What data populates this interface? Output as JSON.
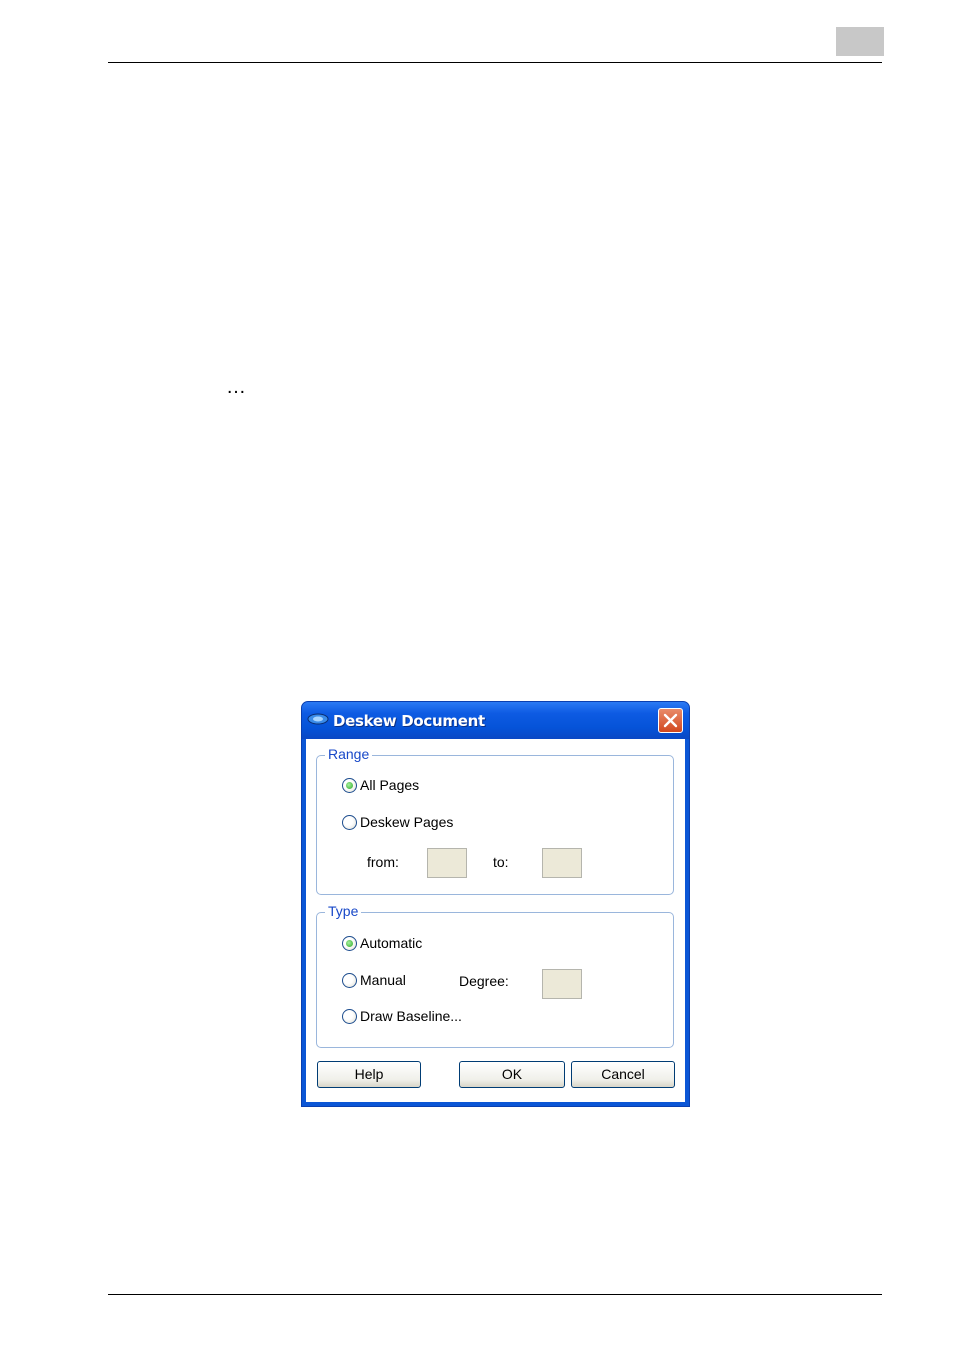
{
  "dialog": {
    "title": "Deskew Document",
    "range": {
      "legend": "Range",
      "all_pages": "All Pages",
      "deskew_pages": "Deskew Pages",
      "from_label": "from:",
      "to_label": "to:",
      "from_value": "",
      "to_value": "",
      "selected": "all_pages"
    },
    "type": {
      "legend": "Type",
      "automatic": "Automatic",
      "manual": "Manual",
      "degree_label": "Degree:",
      "degree_value": "",
      "draw_baseline": "Draw Baseline...",
      "selected": "automatic"
    },
    "buttons": {
      "help": "Help",
      "ok": "OK",
      "cancel": "Cancel"
    }
  },
  "page": {
    "ellipsis": "…"
  },
  "colors": {
    "titlebar": "#0553d8",
    "group_legend": "#1848c8",
    "close": "#d2471f",
    "input_fill": "#ece9d8"
  },
  "icons": [
    "app-icon",
    "close-icon"
  ]
}
